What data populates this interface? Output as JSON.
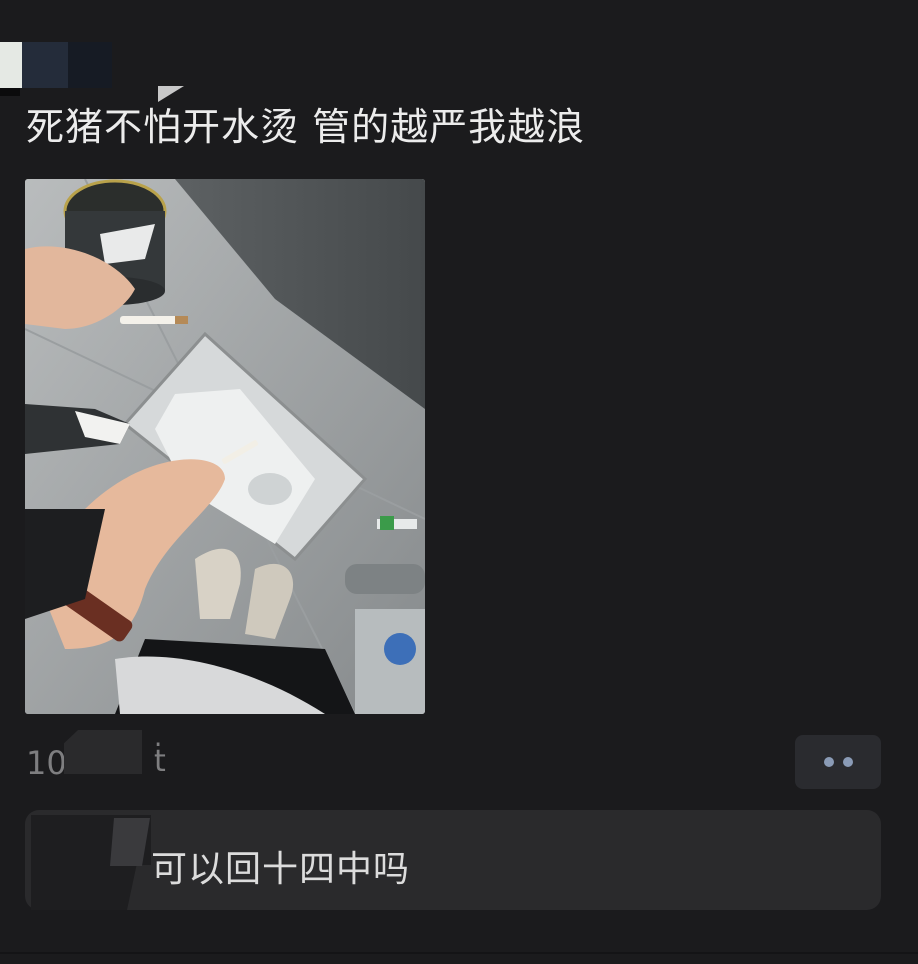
{
  "post": {
    "title": "死猪不怕开水烫 管的越严我越浪",
    "photo_alt": "photo"
  },
  "stats": {
    "count": "10",
    "share_glyph": "ṫ",
    "more_icon": "more-dots-icon"
  },
  "comment": {
    "text": "可以回十四中吗"
  },
  "colors": {
    "background": "#1b1b1d",
    "card": "#2a2a2c",
    "dots": "#8a9bb6"
  }
}
